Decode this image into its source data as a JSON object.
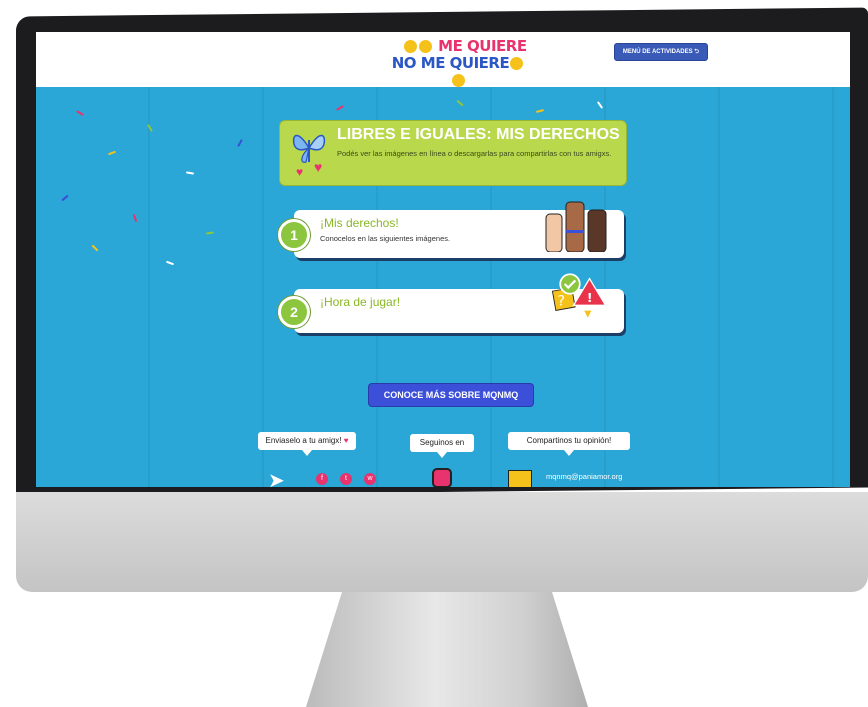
{
  "header": {
    "logo_line1": "ME QUIERE",
    "logo_line2": "NO ME QUIERE",
    "menu_button": "MENÚ DE ACTIVIDADES ⮌"
  },
  "hero": {
    "title": "LIBRES E IGUALES: MIS DERECHOS",
    "description": "Podés ver las imágenes en línea o descargarlas para compartirlas con tus amigxs."
  },
  "cards": [
    {
      "number": "1",
      "title": "¡Mis derechos!",
      "description": "Conocelos en las siguientes imágenes."
    },
    {
      "number": "2",
      "title": "¡Hora de jugar!",
      "description": ""
    }
  ],
  "cta": {
    "label": "CONOCE MÁS SOBRE MQNMQ"
  },
  "footer": {
    "share_label": "Enviaselo a tu amigx!",
    "follow_label": "Seguinos en",
    "opinion_label": "Compartinos tu opinión!",
    "email": "mqnmq@paniamor.org"
  },
  "colors": {
    "background": "#2aa7d6",
    "accent_green": "#b9d84b",
    "brand_pink": "#e8336e",
    "brand_blue": "#2a56c6",
    "cta_blue": "#3b4fd9"
  },
  "icons": [
    "butterfly-icon",
    "heart-icon",
    "fists-illustration",
    "warning-icon",
    "check-icon",
    "paper-plane-icon",
    "facebook-icon",
    "twitter-icon",
    "whatsapp-icon",
    "instagram-icon",
    "envelope-icon"
  ]
}
